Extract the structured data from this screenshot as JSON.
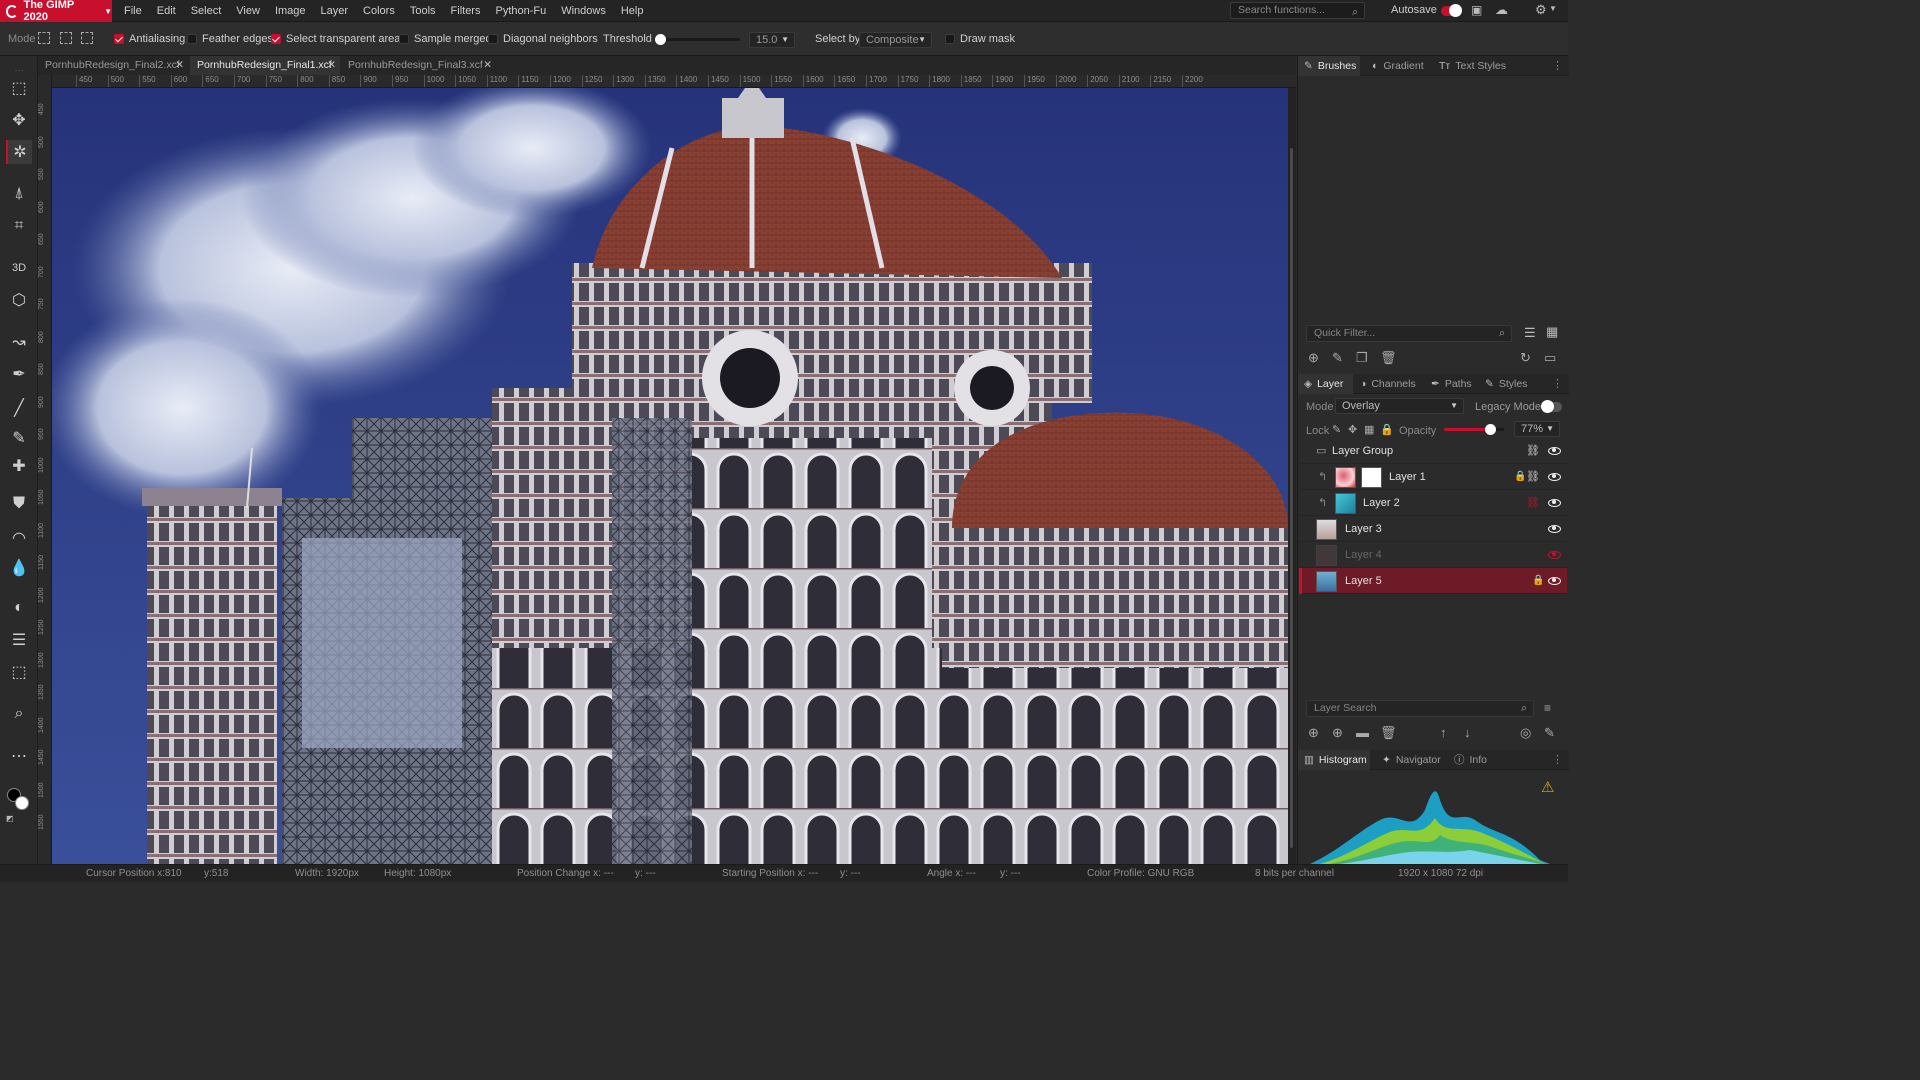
{
  "app": {
    "title": "The GIMP 2020"
  },
  "menu": [
    "File",
    "Edit",
    "Select",
    "View",
    "Image",
    "Layer",
    "Colors",
    "Tools",
    "Filters",
    "Python-Fu",
    "Windows",
    "Help"
  ],
  "search_functions": {
    "placeholder": "Search functions..."
  },
  "autosave": {
    "label": "Autosave",
    "on": true
  },
  "tool_options": {
    "mode_label": "Mode",
    "antialiasing": {
      "label": "Antialiasing",
      "checked": true
    },
    "feather_edges": {
      "label": "Feather edges",
      "checked": false
    },
    "select_transparent": {
      "label": "Select transparent areas",
      "checked": true
    },
    "sample_merged": {
      "label": "Sample merged",
      "checked": false
    },
    "diagonal_neighbors": {
      "label": "Diagonal neighbors",
      "checked": false
    },
    "threshold_label": "Threshold",
    "threshold_value": "15.0",
    "threshold_fraction": 0.05,
    "select_by_label": "Select by",
    "select_by_value": "Composite",
    "draw_mask": {
      "label": "Draw mask",
      "checked": false
    }
  },
  "doc_tabs": [
    {
      "label": "PornhubRedesign_Final2.xcf",
      "active": false
    },
    {
      "label": "PornhubRedesign_Final1.xcf",
      "active": true
    },
    {
      "label": "PornhubRedesign_Final3.xcf",
      "active": false
    }
  ],
  "ruler_h": [
    "450",
    "500",
    "550",
    "600",
    "650",
    "700",
    "750",
    "800",
    "850",
    "900",
    "950",
    "1000",
    "1050",
    "1100",
    "1150",
    "1200",
    "1250",
    "1300",
    "1350",
    "1400",
    "1450",
    "1500",
    "1550",
    "1600",
    "1650",
    "1700",
    "1750",
    "1800",
    "1850",
    "1900",
    "1950",
    "2000",
    "2050",
    "2100",
    "2150",
    "2200"
  ],
  "ruler_v": [
    "450",
    "500",
    "550",
    "600",
    "650",
    "700",
    "750",
    "800",
    "850",
    "900",
    "950",
    "1000",
    "1050",
    "1100",
    "1150",
    "1200",
    "1250",
    "1300",
    "1350",
    "1400",
    "1450",
    "1500",
    "1550"
  ],
  "brushes_panel": {
    "tabs": [
      "Brushes",
      "Gradient",
      "Text Styles"
    ],
    "quick_filter_placeholder": "Quick Filter..."
  },
  "layers_panel": {
    "tabs": [
      "Layer",
      "Channels",
      "Paths",
      "Styles"
    ],
    "mode_label": "Mode",
    "mode_value": "Overlay",
    "legacy_mode_label": "Legacy Mode",
    "lock_label": "Lock",
    "opacity_label": "Opacity",
    "opacity_value": "77%",
    "opacity_fraction": 0.77,
    "group_name": "Layer Group",
    "layers": [
      {
        "name": "Layer 1",
        "visible": true,
        "locked": true,
        "linked": true,
        "in_group": true
      },
      {
        "name": "Layer 2",
        "visible": true,
        "locked": false,
        "linked": false,
        "in_group": true
      },
      {
        "name": "Layer 3",
        "visible": true,
        "locked": false,
        "linked": false,
        "in_group": false
      },
      {
        "name": "Layer 4",
        "visible": false,
        "locked": false,
        "linked": false,
        "in_group": false
      },
      {
        "name": "Layer 5",
        "visible": true,
        "locked": true,
        "linked": false,
        "in_group": false,
        "selected": true
      }
    ],
    "layer_search_placeholder": "Layer Search"
  },
  "bottom_panel": {
    "tabs": [
      "Histogram",
      "Navigator",
      "Info"
    ]
  },
  "status": {
    "cursor_x": "Cursor Position x:810",
    "cursor_y": "y:518",
    "width": "Width: 1920px",
    "height": "Height: 1080px",
    "pos_change_x": "Position Change x: ---",
    "pos_change_y": "y: ---",
    "start_x": "Starting Position x: ---",
    "start_y": "y: ---",
    "angle": "Angle x: ---",
    "angle_y": "y: ---",
    "color_profile": "Color Profile: GNU RGB",
    "bits": "8 bits per channel",
    "dims": "1920 x 1080 72 dpi"
  },
  "colors": {
    "accent": "#c8102e",
    "bg": "#2b2b2b",
    "panel": "#262626"
  }
}
